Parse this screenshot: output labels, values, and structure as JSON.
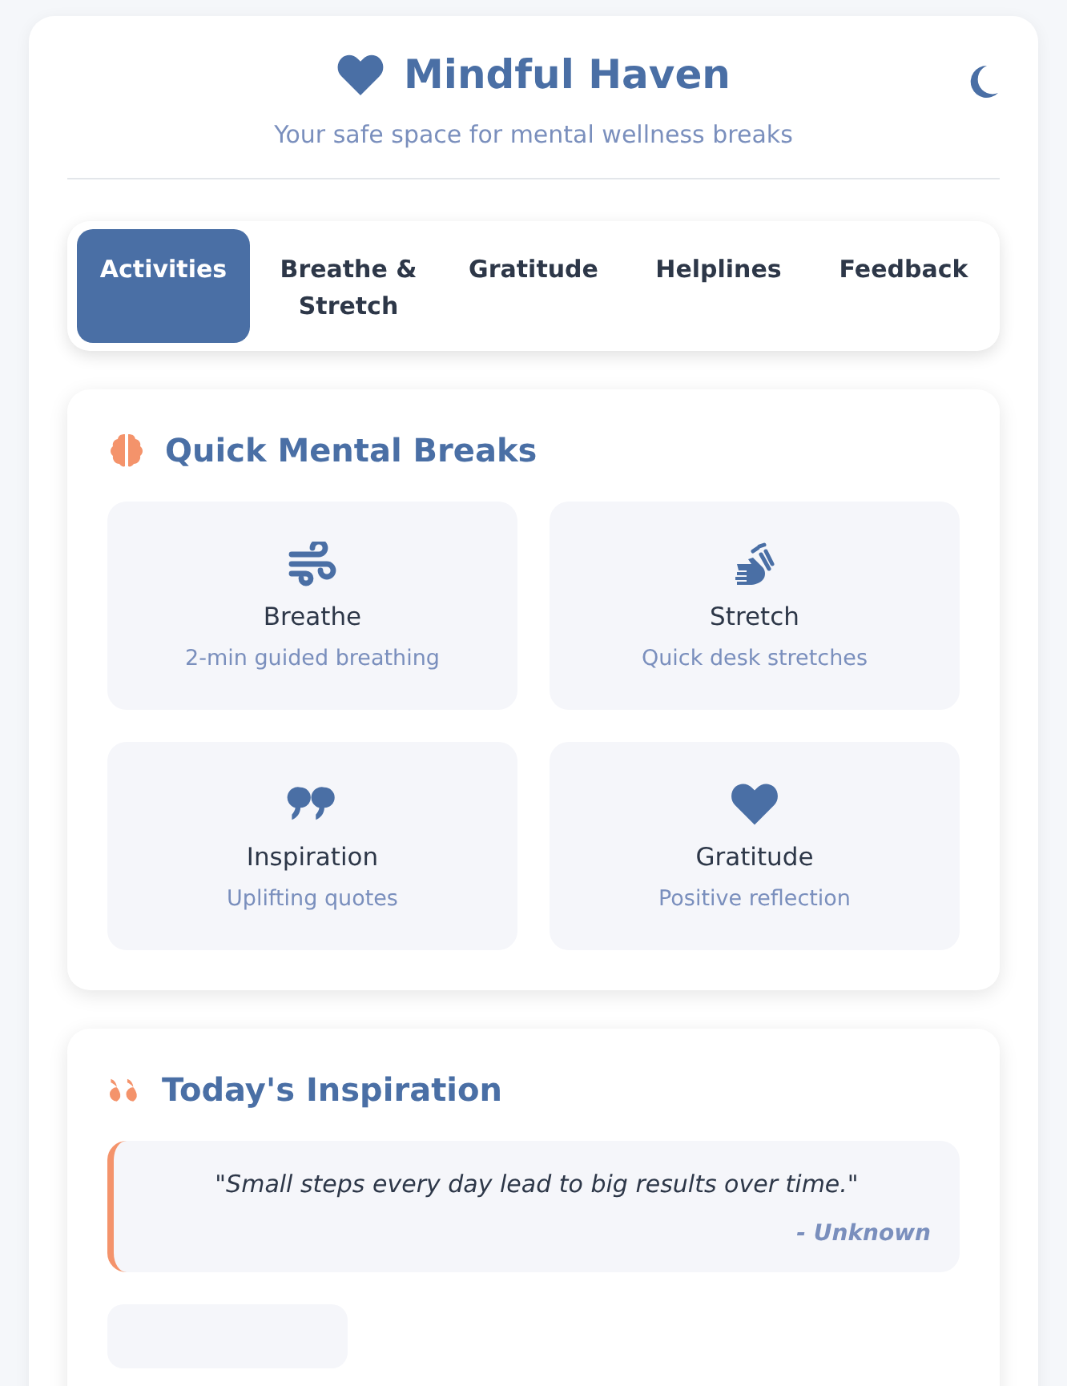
{
  "header": {
    "title": "Mindful Haven",
    "subtitle": "Your safe space for mental wellness breaks"
  },
  "tabs": [
    {
      "label": "Activities",
      "selected": true
    },
    {
      "label": "Breathe & Stretch",
      "selected": false
    },
    {
      "label": "Gratitude",
      "selected": false
    },
    {
      "label": "Helplines",
      "selected": false
    },
    {
      "label": "Feedback",
      "selected": false
    }
  ],
  "breaks_section": {
    "title": "Quick Mental Breaks",
    "activities": [
      {
        "kind": "wind",
        "title": "Breathe",
        "description": "2-min guided breathing"
      },
      {
        "kind": "hands",
        "title": "Stretch",
        "description": "Quick desk stretches"
      },
      {
        "kind": "quote",
        "title": "Inspiration",
        "description": "Uplifting quotes"
      },
      {
        "kind": "heart",
        "title": "Gratitude",
        "description": "Positive reflection"
      }
    ]
  },
  "inspiration_section": {
    "title": "Today's Inspiration",
    "quote": "\"Small steps every day lead to big results over time.\"",
    "author": "- Unknown"
  }
}
